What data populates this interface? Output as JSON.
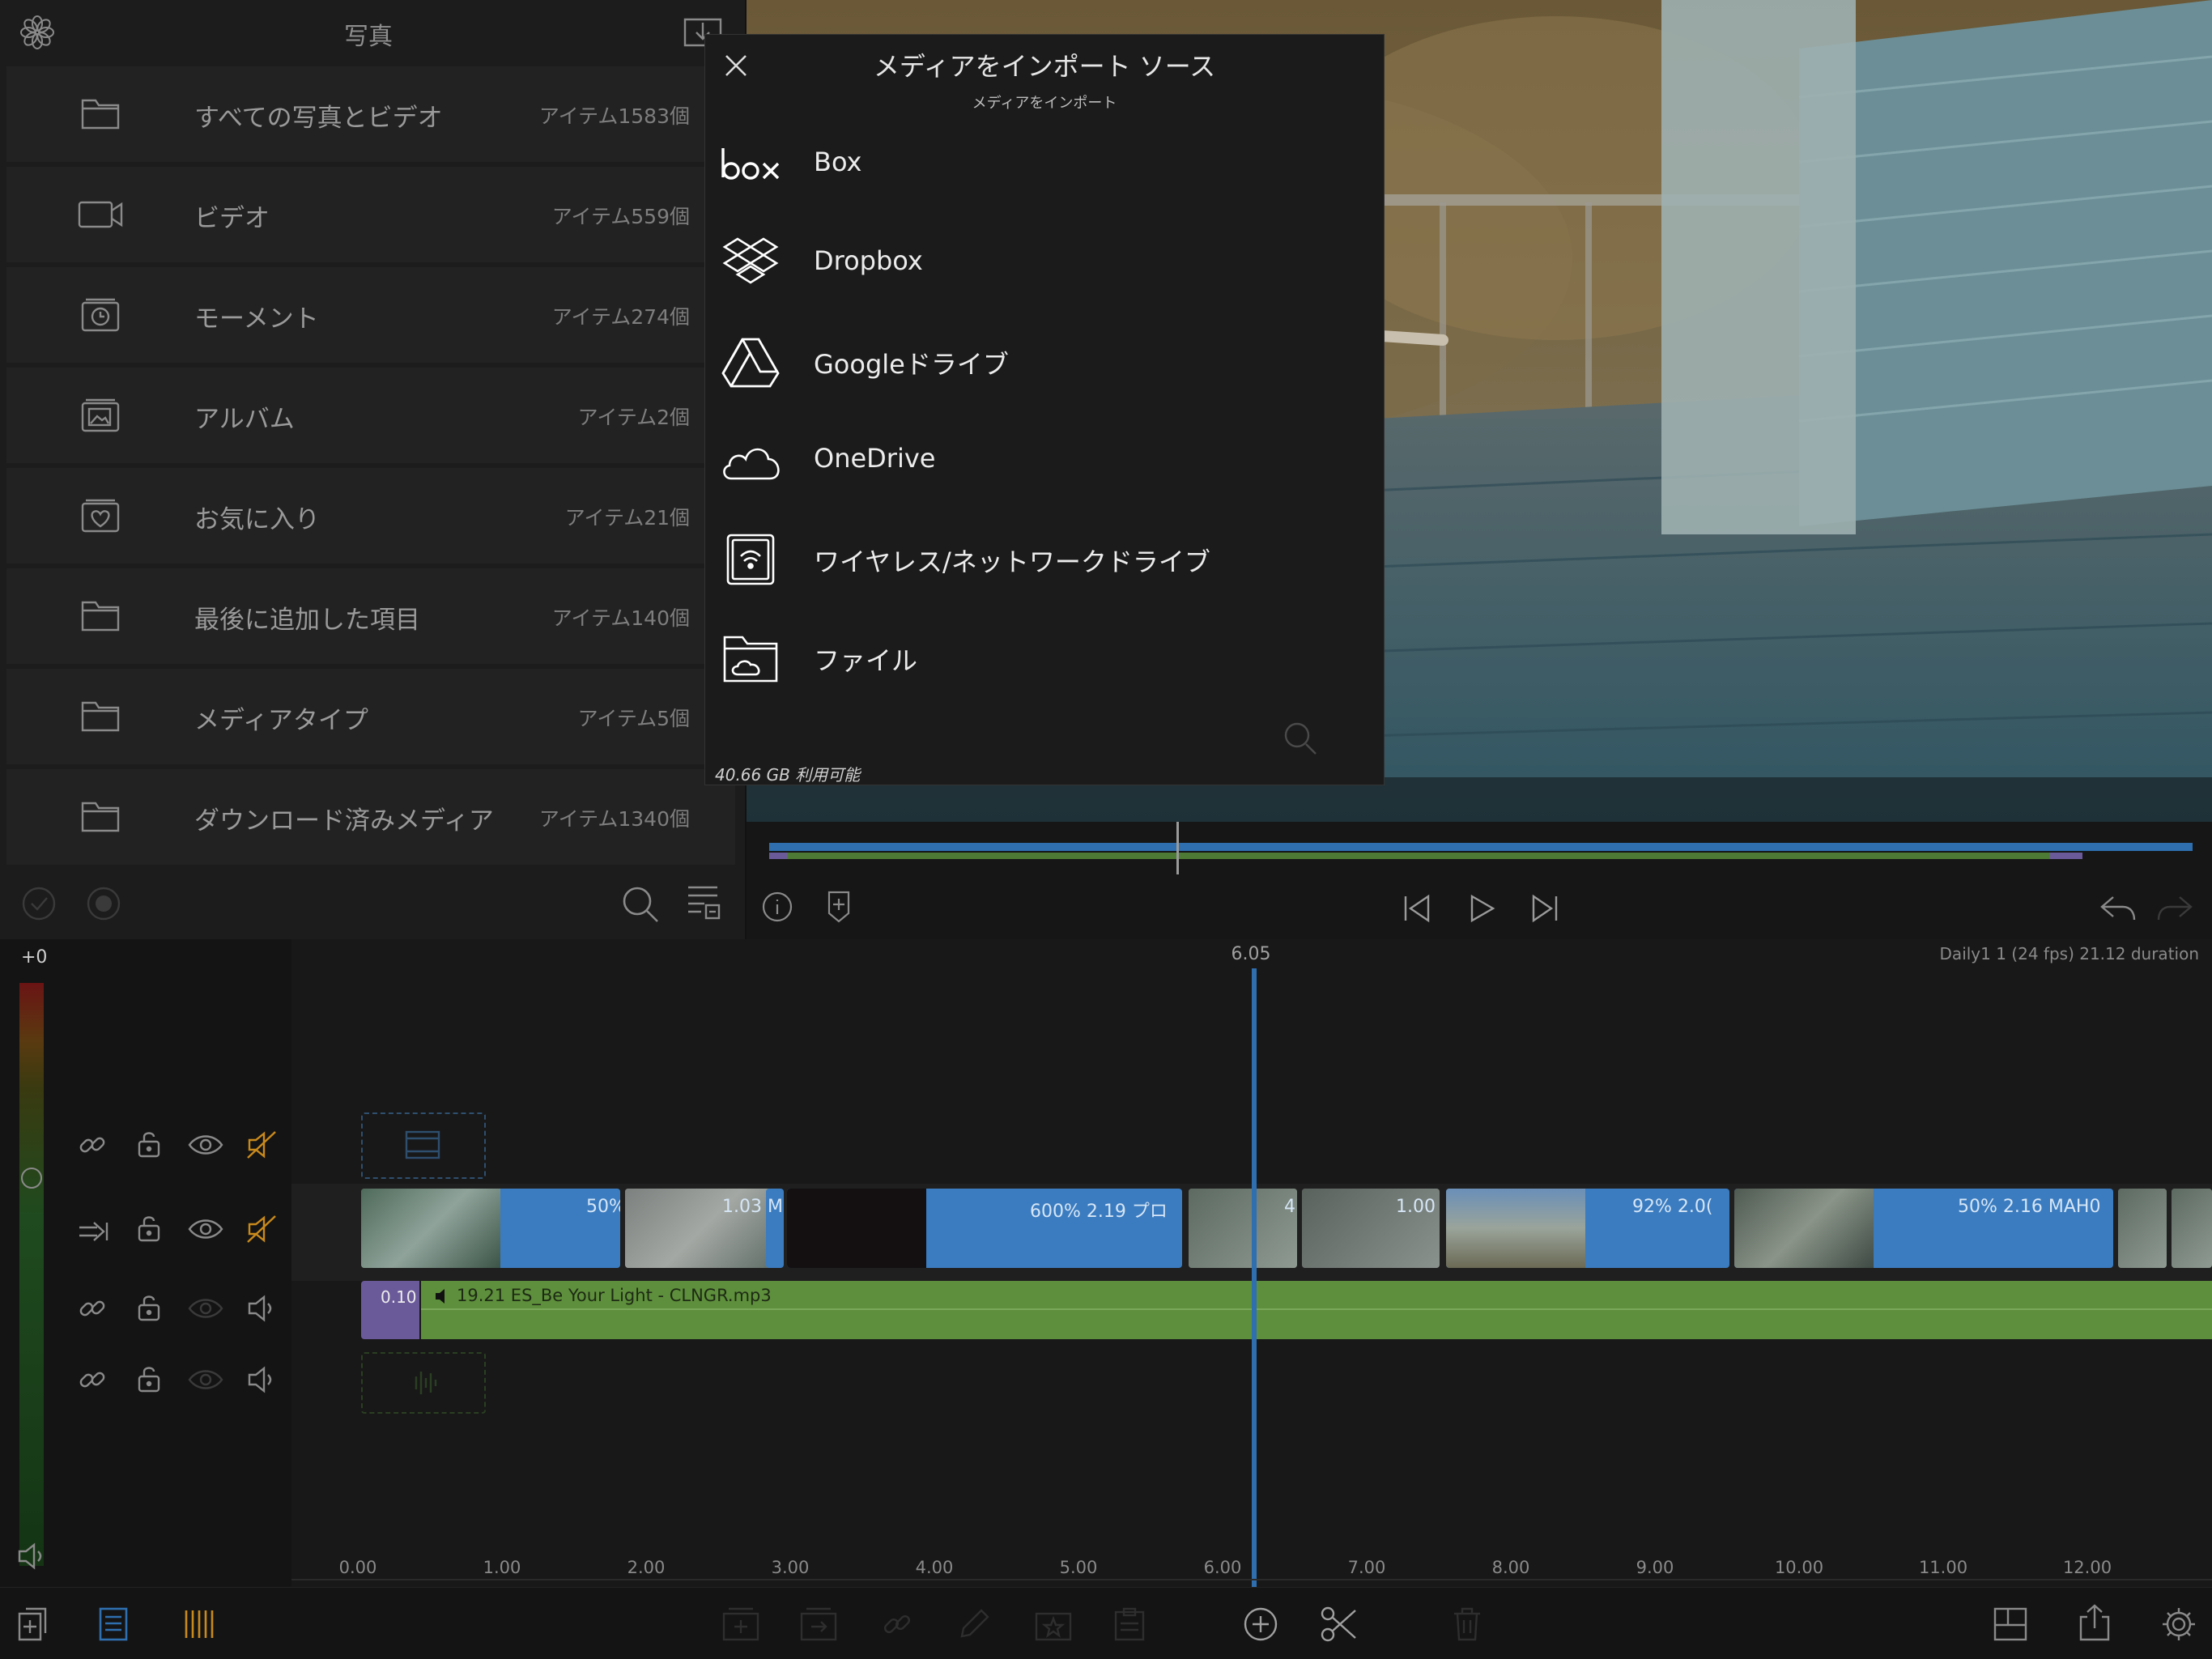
{
  "browser": {
    "title": "写真",
    "items": [
      {
        "label": "すべての写真とビデオ",
        "count": "アイテム1583個",
        "icon": "folder-icon"
      },
      {
        "label": "ビデオ",
        "count": "アイテム559個",
        "icon": "video-camera-icon"
      },
      {
        "label": "モーメント",
        "count": "アイテム274個",
        "icon": "moments-clock-icon"
      },
      {
        "label": "アルバム",
        "count": "アイテム2個",
        "icon": "album-icon"
      },
      {
        "label": "お気に入り",
        "count": "アイテム21個",
        "icon": "favorites-heart-icon"
      },
      {
        "label": "最後に追加した項目",
        "count": "アイテム140個",
        "icon": "folder-icon"
      },
      {
        "label": "メディアタイプ",
        "count": "アイテム5個",
        "icon": "folder-icon"
      },
      {
        "label": "ダウンロード済みメディア",
        "count": "アイテム1340個",
        "icon": "folder-icon"
      }
    ]
  },
  "popover": {
    "title": "メディアをインポート ソース",
    "subtitle": "メディアをインポート",
    "sources": [
      {
        "label": "Box",
        "icon": "box-logo-icon"
      },
      {
        "label": "Dropbox",
        "icon": "dropbox-logo-icon"
      },
      {
        "label": "Googleドライブ",
        "icon": "google-drive-logo-icon"
      },
      {
        "label": "OneDrive",
        "icon": "onedrive-cloud-icon"
      },
      {
        "label": "ワイヤレス/ネットワークドライブ",
        "icon": "wireless-drive-icon"
      },
      {
        "label": "ファイル",
        "icon": "files-folder-icon"
      }
    ],
    "free_space": "40.66 GB 利用可能"
  },
  "timeline": {
    "level": "+0",
    "playhead_time": "6.05",
    "project_info": "Daily1 1 (24 fps) 21.12 duration",
    "ruler": [
      "0.00",
      "1.00",
      "2.00",
      "3.00",
      "4.00",
      "5.00",
      "6.00",
      "7.00",
      "8.00",
      "9.00",
      "10.00",
      "11.00",
      "12.00"
    ],
    "clips": [
      {
        "text": "50%"
      },
      {
        "text": "1.03"
      },
      {
        "text": "M"
      },
      {
        "text": "600%  2.19  プロ"
      },
      {
        "text": "4"
      },
      {
        "text": "1.00"
      },
      {
        "text": "92%  2.0("
      },
      {
        "text": "50%  2.16  MAH0"
      }
    ],
    "audio_fade": "0.10",
    "audio_clip": "19.21  ES_Be Your Light - CLNGR.mp3"
  },
  "colors": {
    "accent_blue": "#2f6fb0",
    "clip_blue": "#3b7cc0",
    "audio_green": "#5e8f3c",
    "purple": "#6b5a9a",
    "mute_orange": "#c98a1c"
  }
}
